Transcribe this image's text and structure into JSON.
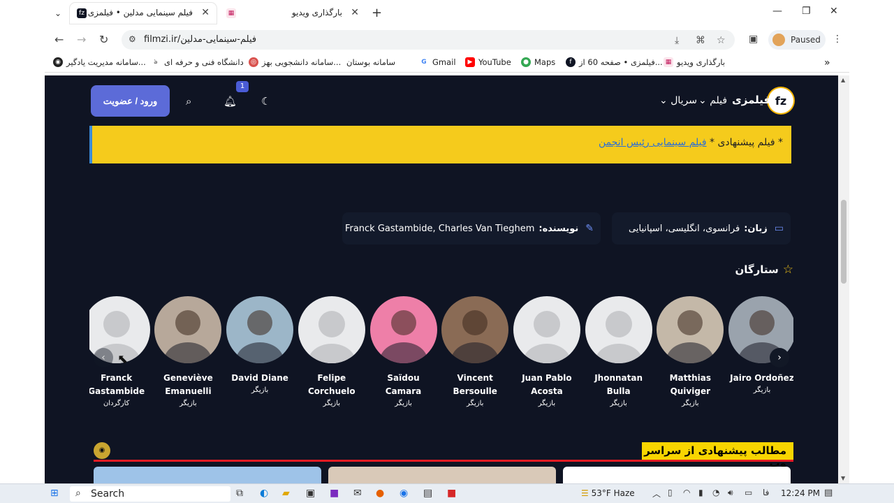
{
  "browser": {
    "tabs": [
      {
        "title": "فیلم سینمایی مدلین • فیلمزی",
        "favicon": "fz-icon",
        "active": true
      },
      {
        "title": "بارگذاری ویدیو",
        "favicon": "upload-icon",
        "active": false
      }
    ],
    "url": "filmzi.ir/فیلم-سینمایی-مدلین",
    "profile_label": "Paused",
    "bookmarks": [
      "سامانه مدیریت یادگیر...",
      "دانشگاه فنی و حرفه ای",
      "سامانه دانشجویی بهز...",
      "سامانه بوستان",
      "Gmail",
      "YouTube",
      "Maps",
      "فیلمزی • صفحه 60 از...",
      "بارگذاری ویدیو"
    ]
  },
  "site": {
    "logo_text": "fz",
    "brand_name": "فیلمزی",
    "menu": [
      "فیلم",
      "سریال"
    ],
    "login_label": "ورود / عضویت",
    "notification_count": "1"
  },
  "notice": {
    "prefix": "* فیلم پیشنهادی * ",
    "link": "فیلم سینمایی رئیس انجمن"
  },
  "info": {
    "language_label": "زبان:",
    "language_value": "فرانسوی، انگلیسی، اسپانیایی",
    "writer_label": "نویسنده:",
    "writer_value": "Franck Gastambide, Charles Van Tieghem"
  },
  "stars_title": "ستارگان",
  "cast": [
    {
      "name": "Jairo Ordoñez",
      "role": "بازیگر",
      "photo": true,
      "bg": "#9aa3ad"
    },
    {
      "name": "Matthias Quiviger",
      "role": "بازیگر",
      "photo": true,
      "bg": "#c4b8a8"
    },
    {
      "name": "Jhonnatan Bulla",
      "role": "بازیگر",
      "photo": false,
      "bg": "#e9eaec"
    },
    {
      "name": "Juan Pablo Acosta",
      "role": "بازیگر",
      "photo": false,
      "bg": "#e9eaec"
    },
    {
      "name": "Vincent Bersoulle",
      "role": "بازیگر",
      "photo": true,
      "bg": "#8a6b55"
    },
    {
      "name": "Saïdou Camara",
      "role": "بازیگر",
      "photo": true,
      "bg": "#ee7fa8"
    },
    {
      "name": "Felipe Corchuelo",
      "role": "بازیگر",
      "photo": false,
      "bg": "#e9eaec"
    },
    {
      "name": "David Diane",
      "role": "بازیگر",
      "photo": true,
      "bg": "#9cb6c8"
    },
    {
      "name": "Geneviève Emanuelli",
      "role": "بازیگر",
      "photo": true,
      "bg": "#b7a89a"
    },
    {
      "name": "Franck Gastambide",
      "role": "کارگردان",
      "photo": false,
      "bg": "#e9eaec"
    }
  ],
  "recommend_title": "مطالب پیشنهادی از سراسر وب",
  "taskbar": {
    "search_label": "Search",
    "weather": "53°F  Haze",
    "lang": "فا",
    "time": "12:24 PM"
  }
}
